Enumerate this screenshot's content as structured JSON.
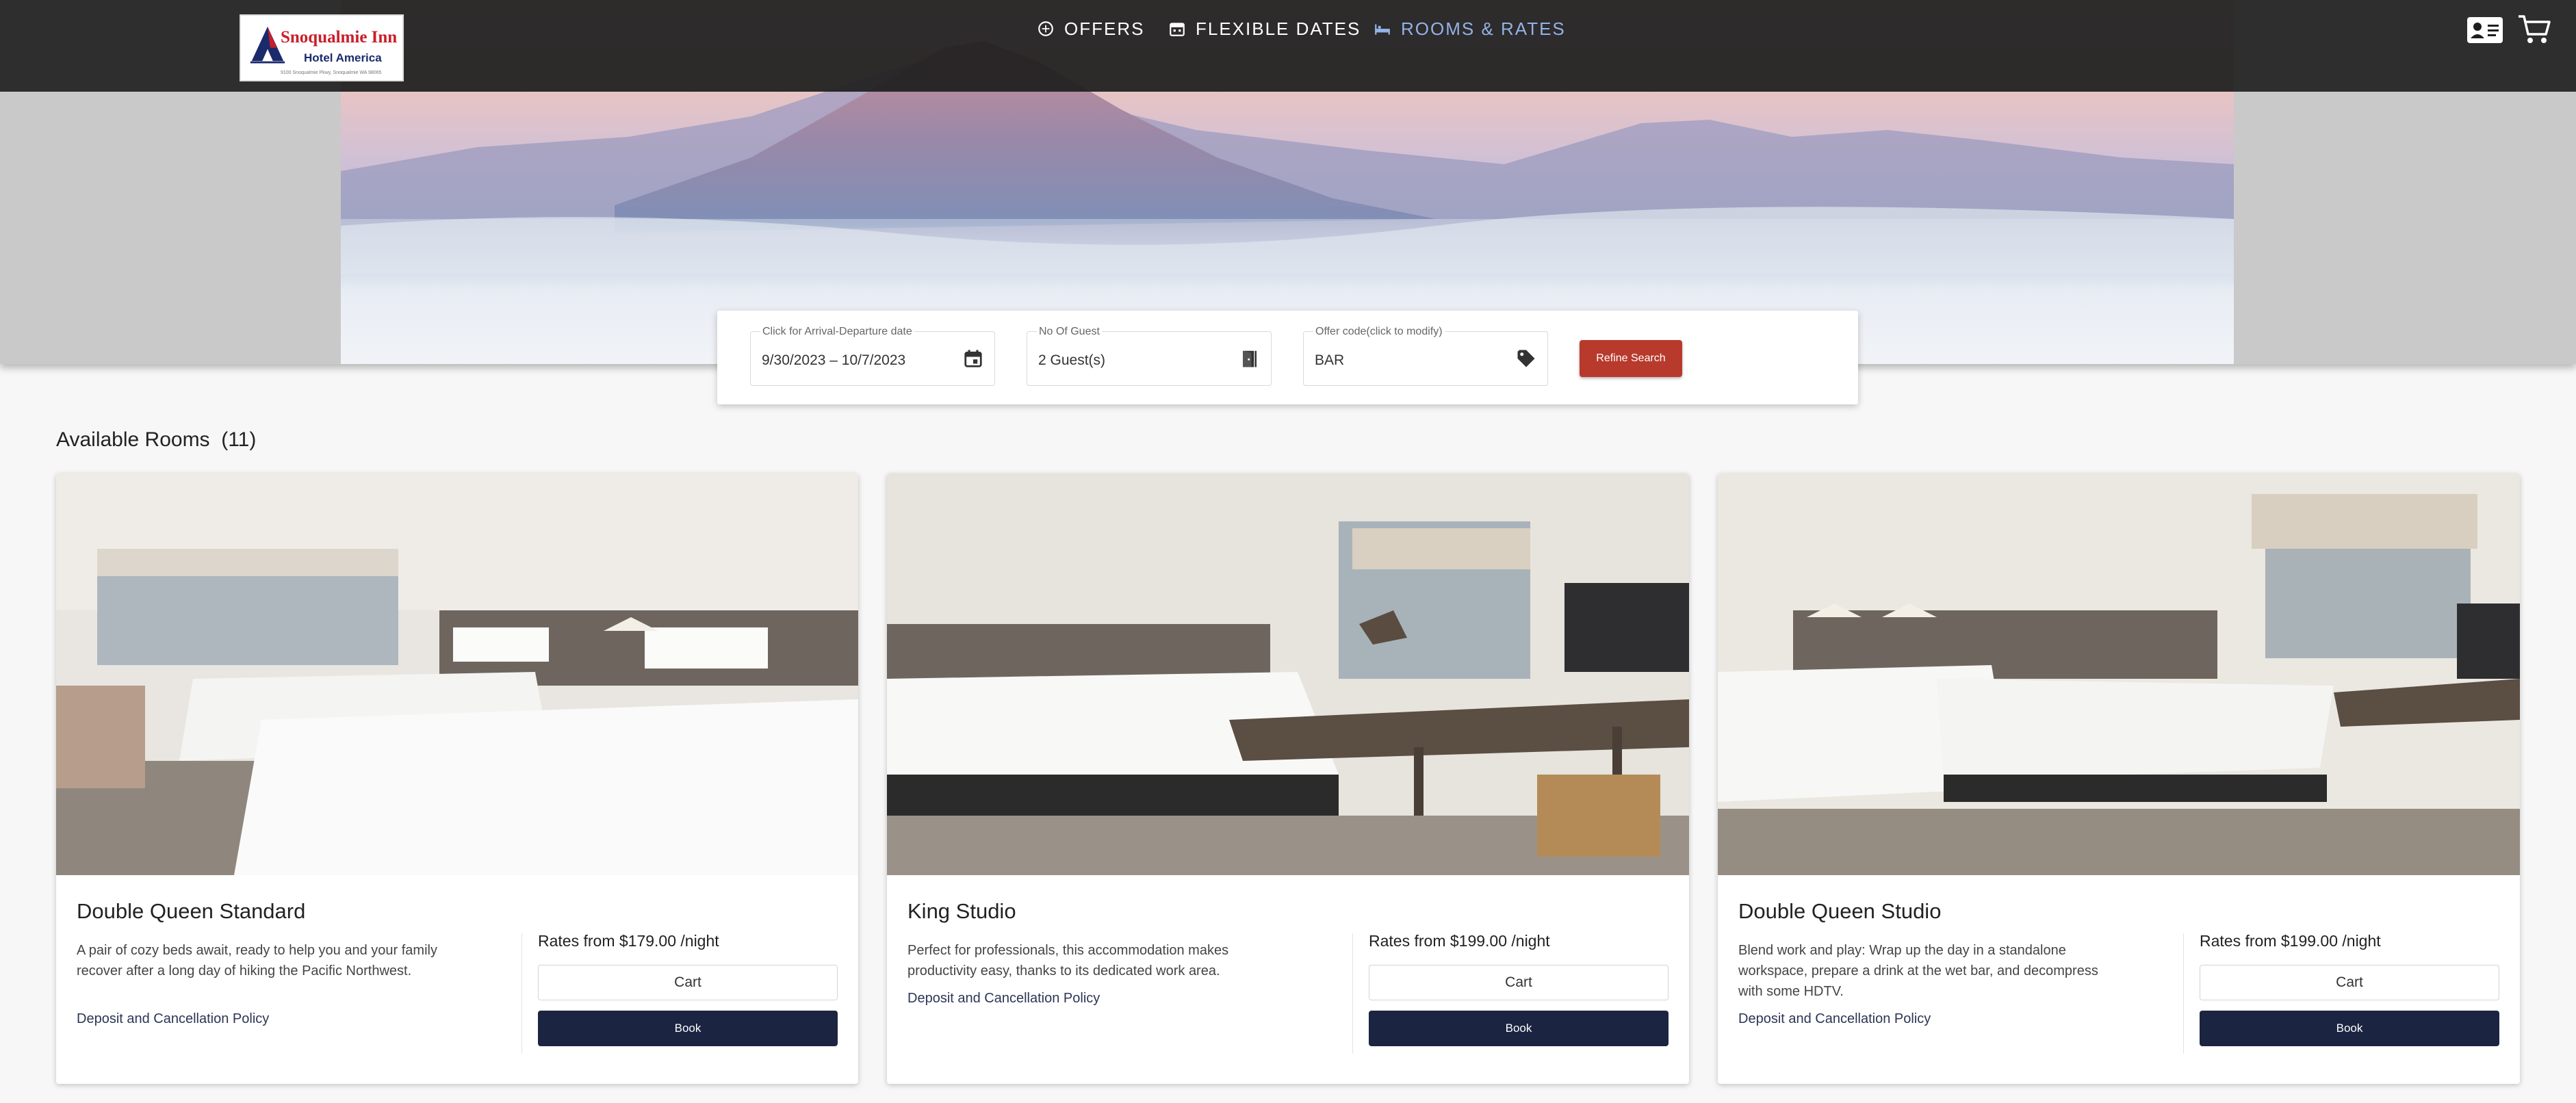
{
  "header": {
    "logo": {
      "name": "Snoqualmie Inn",
      "sub": "Hotel America",
      "line": "9100 Snoqualmie Pkwy, Snoqualmie WA 98065"
    },
    "nav": [
      {
        "label": "OFFERS",
        "icon": "offers-icon"
      },
      {
        "label": "FLEXIBLE DATES",
        "icon": "calendar-icon"
      },
      {
        "label": "ROOMS & RATES",
        "icon": "bed-icon",
        "active": true
      }
    ],
    "icons": [
      "contact-card-icon",
      "cart-icon"
    ],
    "active_color": "#93b2e6"
  },
  "search": {
    "dates": {
      "label": "Click for Arrival-Departure date",
      "value": "9/30/2023 – 10/7/2023",
      "icon": "calendar-icon"
    },
    "guests": {
      "label": "No Of Guest",
      "value": "2 Guest(s)",
      "icon": "door-icon"
    },
    "offer": {
      "label": "Offer code(click to modify)",
      "value": "BAR",
      "icon": "tag-icon"
    },
    "refine_label": "Refine Search",
    "refine_color": "#b73a2c"
  },
  "rooms": {
    "heading": "Available Rooms",
    "count": "(11)",
    "items": [
      {
        "name": "Double Queen Standard",
        "description": "A pair of cozy beds await, ready to help you and your family recover after a long day of hiking the Pacific Northwest.",
        "policy": "Deposit and Cancellation Policy",
        "rate": "Rates from $179.00 /night",
        "cart_label": "Cart",
        "book_label": "Book"
      },
      {
        "name": "King Studio",
        "description": "Perfect for professionals, this accommodation makes productivity easy, thanks to its dedicated work area.",
        "policy": "Deposit and Cancellation Policy",
        "rate": "Rates from $199.00 /night",
        "cart_label": "Cart",
        "book_label": "Book"
      },
      {
        "name": "Double Queen Studio",
        "description": "Blend work and play: Wrap up the day in a standalone workspace, prepare a drink at the wet bar, and decompress with some HDTV.",
        "policy": "Deposit and Cancellation Policy",
        "rate": "Rates from $199.00 /night",
        "cart_label": "Cart",
        "book_label": "Book"
      }
    ],
    "book_color": "#1b2441"
  }
}
